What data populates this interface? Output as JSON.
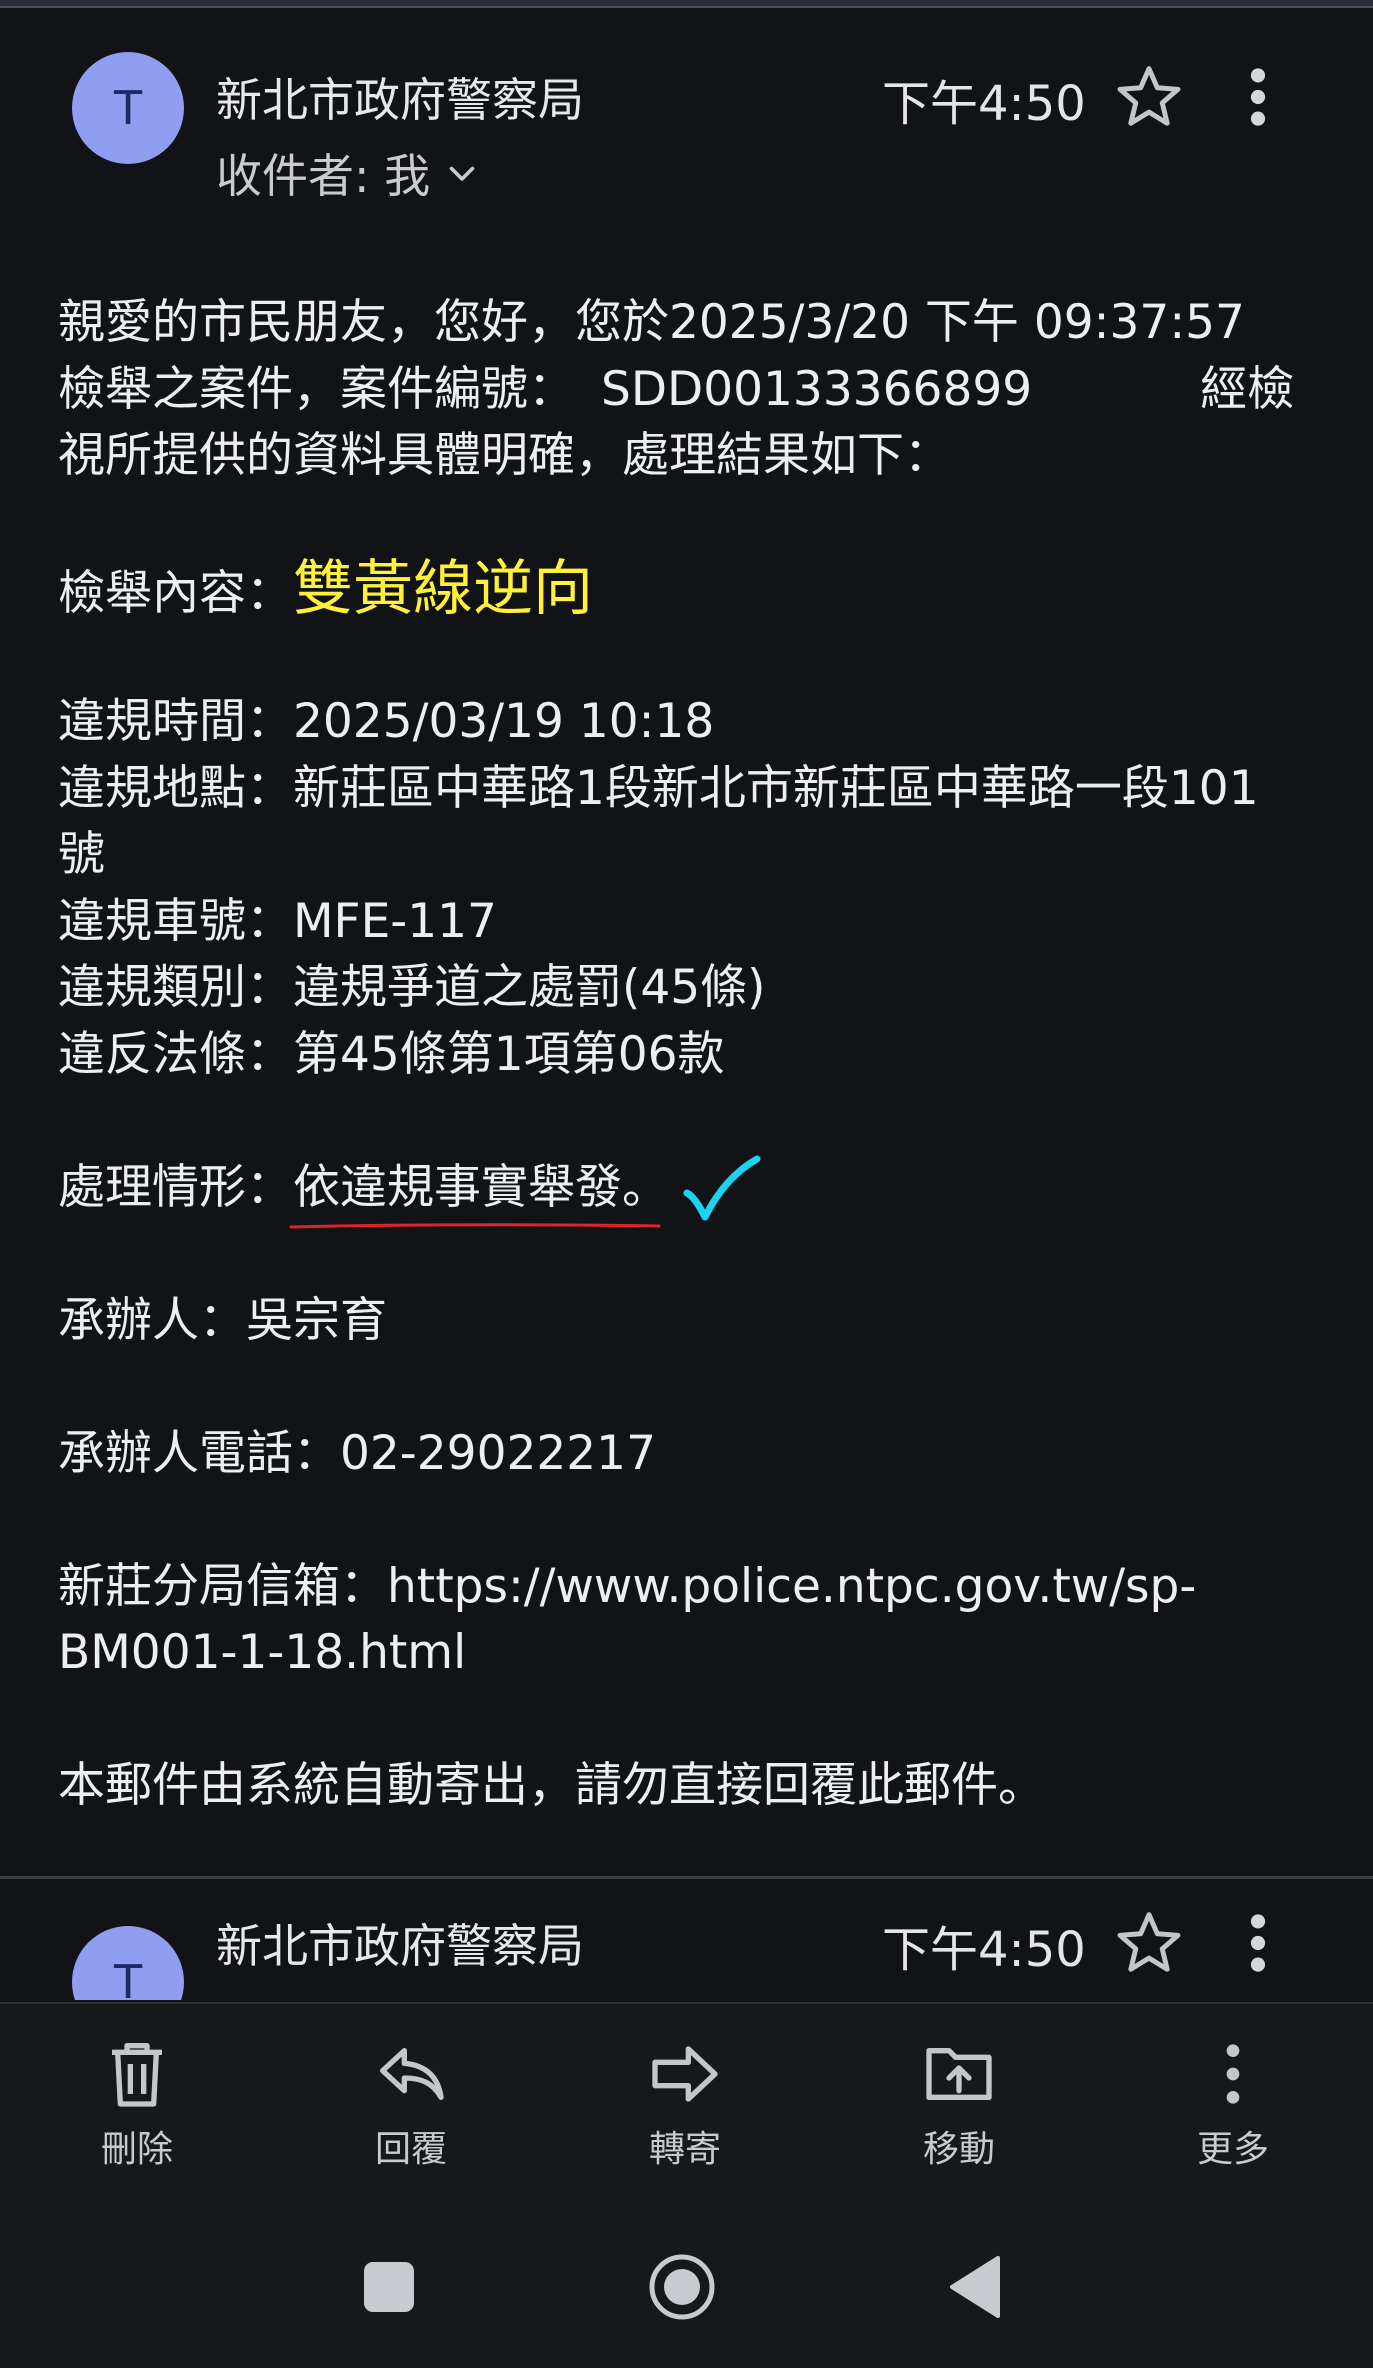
{
  "email": {
    "avatar_letter": "T",
    "sender": "新北市政府警察局",
    "recipient": "收件者: 我",
    "time": "下午4:50",
    "body": {
      "line1": "親愛的市民朋友，您好，您於2025/3/20 下午 09:37:57",
      "line2_prefix": "檢舉之案件，案件編號：",
      "case_number": "SDD00133366899",
      "line2_suffix": "經檢",
      "line3": "視所提供的資料具體明確，處理結果如下：",
      "report_label": "檢舉內容：",
      "report_value": "雙黃線逆向",
      "time_label": "違規時間：",
      "time_value": "2025/03/19 10:18",
      "location_label": "違規地點：",
      "location_value": "新莊區中華路1段新北市新莊區中華路一段101",
      "location_cont": "號",
      "plate_label": "違規車號：",
      "plate_value": "MFE-117",
      "category_label": "違規類別：",
      "category_value": "違規爭道之處罰(45條)",
      "law_label": "違反法條：",
      "law_value": "第45條第1項第06款",
      "status_label": "處理情形：",
      "status_value": "依違規事實舉發",
      "status_end": "。",
      "handler_label": "承辦人：",
      "handler_value": "吳宗育",
      "phone_label": "承辦人電話：",
      "phone_value": "02-29022217",
      "mailbox_label": "新莊分局信箱：",
      "mailbox_url_1": "https://www.police.ntpc.gov.tw/sp-",
      "mailbox_url_2": "BM001-1-18.html",
      "footer": "本郵件由系統自動寄出，請勿直接回覆此郵件。"
    }
  },
  "second_email": {
    "avatar_letter": "T",
    "sender": "新北市政府警察局",
    "time": "下午4:50"
  },
  "toolbar": {
    "delete": "刪除",
    "reply": "回覆",
    "forward": "轉寄",
    "move": "移動",
    "more": "更多"
  },
  "colors": {
    "background": "#121317",
    "avatar": "#8f9ef0",
    "highlight_yellow": "#fff03a",
    "check_cyan": "#19d3f0",
    "annotation_red": "#e0242b"
  }
}
